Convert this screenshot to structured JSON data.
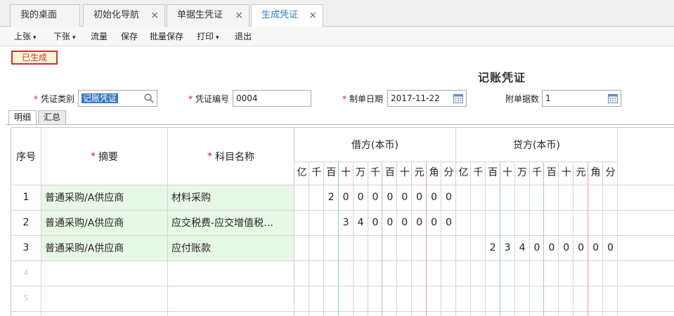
{
  "tabs": [
    {
      "label": "我的桌面",
      "closable": false
    },
    {
      "label": "初始化导航",
      "closable": true
    },
    {
      "label": "单据生凭证",
      "closable": true
    },
    {
      "label": "生成凭证",
      "closable": true,
      "active": true
    }
  ],
  "close_glyph": "×",
  "toolbar": {
    "prev": "上张",
    "next": "下张",
    "flow": "流量",
    "save": "保存",
    "batch_save": "批量保存",
    "print": "打印",
    "exit": "退出",
    "caret": "▾"
  },
  "status": {
    "label": "已生成",
    "color": "#cc3333"
  },
  "document": {
    "title": "记账凭证"
  },
  "required_mark": "*",
  "fields": {
    "voucher_type": {
      "label": "凭证类别",
      "value": "记账凭证",
      "icon": "search-icon"
    },
    "voucher_no": {
      "label": "凭证编号",
      "value": "0004"
    },
    "date": {
      "label": "制单日期",
      "value": "2017-11-22",
      "icon": "calendar-icon"
    },
    "attachments": {
      "label": "附单据数",
      "value": "1",
      "icon": "calendar-icon"
    }
  },
  "inner_tabs": [
    {
      "label": "明细",
      "active": true
    },
    {
      "label": "汇总"
    }
  ],
  "grid": {
    "headers": {
      "seq": "序号",
      "summary": "摘要",
      "account": "科目名称",
      "debit": "借方(本币)",
      "credit": "贷方(本币)"
    },
    "units": [
      "亿",
      "千",
      "百",
      "十",
      "万",
      "千",
      "百",
      "十",
      "元",
      "角",
      "分"
    ],
    "rows": [
      {
        "seq": "1",
        "summary": "普通采购/A供应商",
        "account": "材料采购",
        "debit": "2000000000",
        "credit": "",
        "debit_digits": [
          "",
          "",
          "2",
          "0",
          "0",
          "0",
          "0",
          "0",
          "0",
          "0",
          "0"
        ],
        "credit_digits": [
          "",
          "",
          "",
          "",
          "",
          "",
          "",
          "",
          "",
          "",
          ""
        ]
      },
      {
        "seq": "2",
        "summary": "普通采购/A供应商",
        "account": "应交税费-应交增值税…",
        "debit": "340000000",
        "credit": "",
        "debit_digits": [
          "",
          "",
          "",
          "3",
          "4",
          "0",
          "0",
          "0",
          "0",
          "0",
          "0"
        ],
        "credit_digits": [
          "",
          "",
          "",
          "",
          "",
          "",
          "",
          "",
          "",
          "",
          ""
        ]
      },
      {
        "seq": "3",
        "summary": "普通采购/A供应商",
        "account": "应付账款",
        "debit": "",
        "credit": "2340000000",
        "debit_digits": [
          "",
          "",
          "",
          "",
          "",
          "",
          "",
          "",
          "",
          "",
          ""
        ],
        "credit_digits": [
          "",
          "",
          "2",
          "3",
          "4",
          "0",
          "0",
          "0",
          "0",
          "0",
          "0"
        ]
      },
      {
        "seq": "4",
        "summary": "",
        "account": "",
        "debit": "",
        "credit": ""
      },
      {
        "seq": "5",
        "summary": "",
        "account": "",
        "debit": "",
        "credit": ""
      }
    ]
  }
}
